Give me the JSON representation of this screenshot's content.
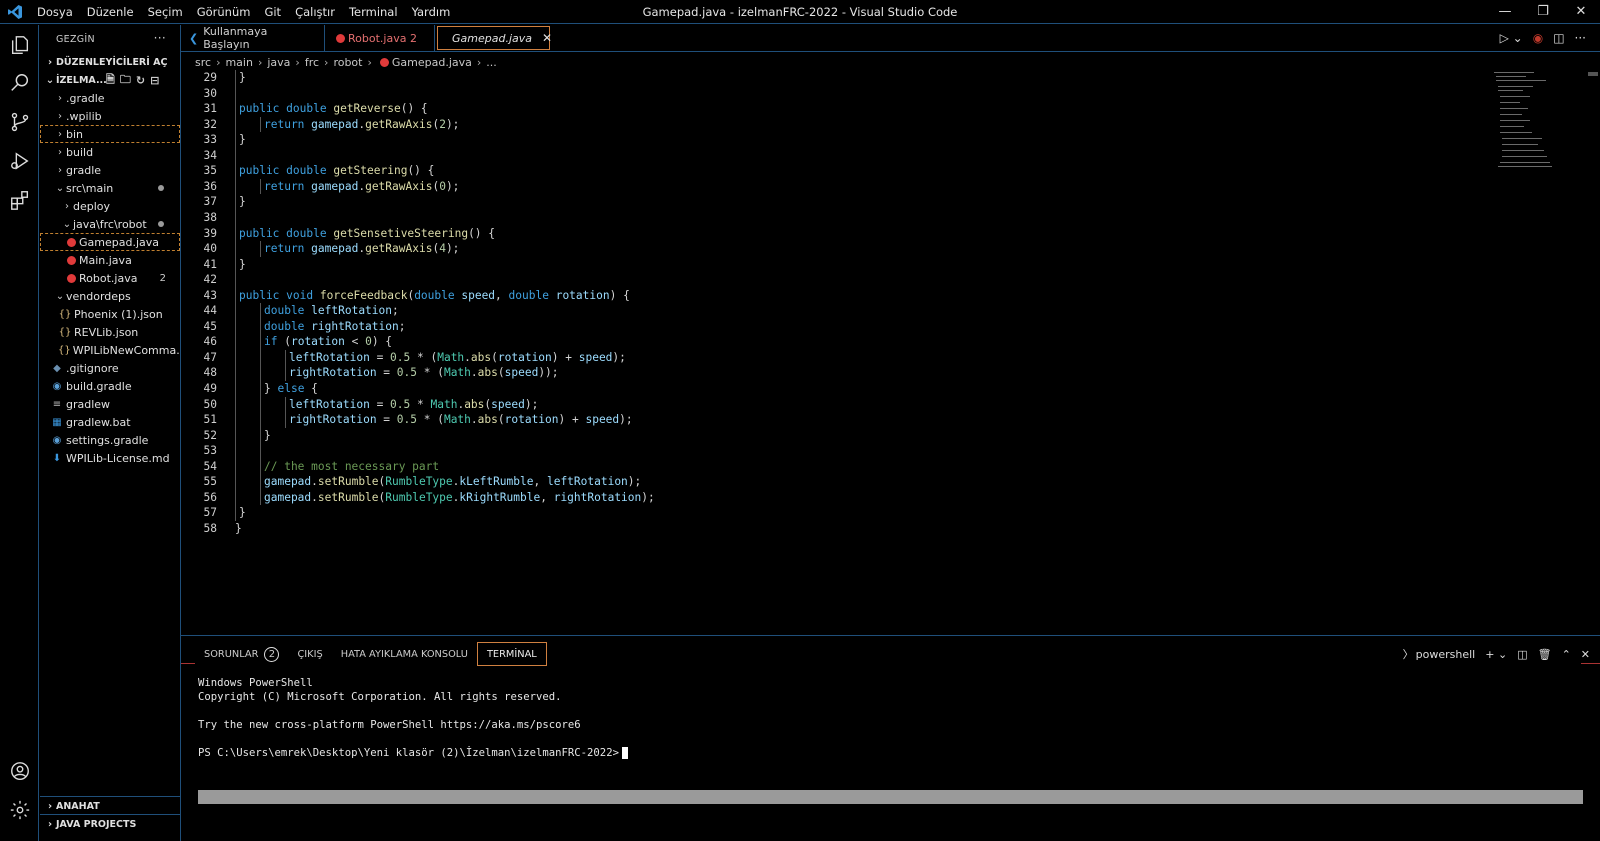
{
  "titlebar": {
    "menu": [
      "Dosya",
      "Düzenle",
      "Seçim",
      "Görünüm",
      "Git",
      "Çalıştır",
      "Terminal",
      "Yardım"
    ],
    "title": "Gamepad.java - izelmanFRC-2022 - Visual Studio Code"
  },
  "sidebar": {
    "header": "GEZGİN",
    "open_editors": "DÜZENLEYİCİLERİ AÇ",
    "workspace": "İZELMA...",
    "items": [
      {
        "label": ".gradle",
        "badge": ""
      },
      {
        "label": ".wpilib",
        "badge": ""
      },
      {
        "label": "bin",
        "badge": ""
      },
      {
        "label": "build",
        "badge": ""
      },
      {
        "label": "gradle",
        "badge": ""
      },
      {
        "label": "src\\main",
        "badge": ""
      },
      {
        "label": "deploy",
        "badge": ""
      },
      {
        "label": "java\\frc\\robot",
        "badge": ""
      },
      {
        "label": "Gamepad.java",
        "badge": ""
      },
      {
        "label": "Main.java",
        "badge": ""
      },
      {
        "label": "Robot.java",
        "badge": "2"
      },
      {
        "label": "vendordeps",
        "badge": ""
      },
      {
        "label": "Phoenix (1).json",
        "badge": ""
      },
      {
        "label": "REVLib.json",
        "badge": ""
      },
      {
        "label": "WPILibNewComma...",
        "badge": ""
      },
      {
        "label": ".gitignore",
        "badge": ""
      },
      {
        "label": "build.gradle",
        "badge": ""
      },
      {
        "label": "gradlew",
        "badge": ""
      },
      {
        "label": "gradlew.bat",
        "badge": ""
      },
      {
        "label": "settings.gradle",
        "badge": ""
      },
      {
        "label": "WPILib-License.md",
        "badge": ""
      }
    ],
    "outline": "ANAHAT",
    "java_projects": "JAVA PROJECTS"
  },
  "tabs": [
    {
      "label": "Kullanmaya Başlayın"
    },
    {
      "label": "Robot.java 2"
    },
    {
      "label": "Gamepad.java"
    }
  ],
  "breadcrumb": [
    "src",
    "main",
    "java",
    "frc",
    "robot",
    "Gamepad.java",
    "..."
  ],
  "code": {
    "line_numbers": [
      "29",
      "30",
      "31",
      "32",
      "33",
      "34",
      "35",
      "36",
      "37",
      "38",
      "39",
      "40",
      "41",
      "42",
      "43",
      "44",
      "45",
      "46",
      "47",
      "48",
      "49",
      "50",
      "51",
      "52",
      "53",
      "54",
      "55",
      "56",
      "57",
      "58"
    ]
  },
  "panel": {
    "tabs": {
      "problems": "SORUNLAR",
      "problems_count": "2",
      "output": "ÇIKIŞ",
      "debug": "HATA AYIKLAMA KONSOLU",
      "terminal": "TERMİNAL"
    },
    "shell": "powershell",
    "terminal_lines": [
      "Windows PowerShell",
      "Copyright (C) Microsoft Corporation. All rights reserved.",
      "",
      "Try the new cross-platform PowerShell https://aka.ms/pscore6",
      "",
      "PS C:\\Users\\emrek\\Desktop\\Yeni klasör (2)\\İzelman\\izelmanFRC-2022>"
    ]
  },
  "colors": {
    "accent": "#3fa1e0",
    "border": "#1f4f7a",
    "focus": "#d08040",
    "error": "#e03a3a"
  }
}
